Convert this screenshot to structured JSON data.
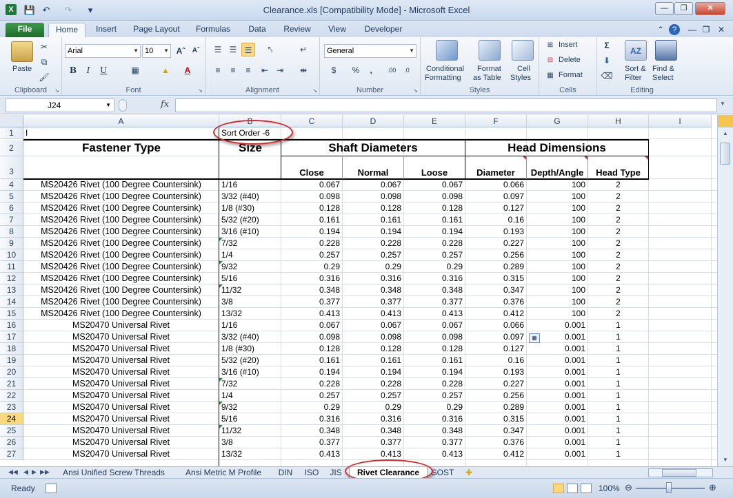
{
  "window": {
    "title": "Clearance.xls  [Compatibility Mode]  -  Microsoft Excel"
  },
  "ribbon_tabs": [
    "File",
    "Home",
    "Insert",
    "Page Layout",
    "Formulas",
    "Data",
    "Review",
    "View",
    "Developer"
  ],
  "ribbon": {
    "clipboard": {
      "label": "Clipboard",
      "paste": "Paste"
    },
    "font": {
      "label": "Font",
      "family": "Arial",
      "size": "10"
    },
    "alignment": {
      "label": "Alignment"
    },
    "number": {
      "label": "Number",
      "format": "General",
      "currency": "$",
      "percent": "%",
      "comma": ","
    },
    "styles": {
      "label": "Styles",
      "cond_fmt_1": "Conditional",
      "cond_fmt_2": "Formatting",
      "fmt_table_1": "Format",
      "fmt_table_2": "as Table",
      "cell_styles_1": "Cell",
      "cell_styles_2": "Styles"
    },
    "cells": {
      "label": "Cells",
      "insert": "Insert",
      "delete": "Delete",
      "format": "Format"
    },
    "editing": {
      "label": "Editing",
      "sort_1": "Sort &",
      "sort_2": "Filter",
      "find_1": "Find &",
      "find_2": "Select"
    }
  },
  "formula_bar": {
    "name_box": "J24",
    "fx": "fx",
    "formula": ""
  },
  "columns": [
    "A",
    "B",
    "C",
    "D",
    "E",
    "F",
    "G",
    "H",
    "I"
  ],
  "header_cells": {
    "a1": "I",
    "b1": "Sort Order -6",
    "fastener_type": "Fastener Type",
    "size": "Size",
    "shaft_diameters": "Shaft Diameters",
    "head_dimensions": "Head Dimensions",
    "close": "Close",
    "normal": "Normal",
    "loose": "Loose",
    "diameter": "Diameter",
    "depth_angle": "Depth/Angle",
    "head_type": "Head Type"
  },
  "rows": [
    {
      "n": "4",
      "a": "MS20426 Rivet (100 Degree Countersink)",
      "b": "1/16",
      "c": "0.067",
      "d": "0.067",
      "e": "0.067",
      "f": "0.066",
      "g": "100",
      "h": "2"
    },
    {
      "n": "5",
      "a": "MS20426 Rivet (100 Degree Countersink)",
      "b": "3/32 (#40)",
      "c": "0.098",
      "d": "0.098",
      "e": "0.098",
      "f": "0.097",
      "g": "100",
      "h": "2"
    },
    {
      "n": "6",
      "a": "MS20426 Rivet (100 Degree Countersink)",
      "b": "1/8 (#30)",
      "c": "0.128",
      "d": "0.128",
      "e": "0.128",
      "f": "0.127",
      "g": "100",
      "h": "2"
    },
    {
      "n": "7",
      "a": "MS20426 Rivet (100 Degree Countersink)",
      "b": "5/32 (#20)",
      "c": "0.161",
      "d": "0.161",
      "e": "0.161",
      "f": "0.16",
      "g": "100",
      "h": "2"
    },
    {
      "n": "8",
      "a": "MS20426 Rivet (100 Degree Countersink)",
      "b": "3/16 (#10)",
      "c": "0.194",
      "d": "0.194",
      "e": "0.194",
      "f": "0.193",
      "g": "100",
      "h": "2"
    },
    {
      "n": "9",
      "a": "MS20426 Rivet (100 Degree Countersink)",
      "b": "7/32",
      "c": "0.228",
      "d": "0.228",
      "e": "0.228",
      "f": "0.227",
      "g": "100",
      "h": "2"
    },
    {
      "n": "10",
      "a": "MS20426 Rivet (100 Degree Countersink)",
      "b": "1/4",
      "c": "0.257",
      "d": "0.257",
      "e": "0.257",
      "f": "0.256",
      "g": "100",
      "h": "2"
    },
    {
      "n": "11",
      "a": "MS20426 Rivet (100 Degree Countersink)",
      "b": "9/32",
      "c": "0.29",
      "d": "0.29",
      "e": "0.29",
      "f": "0.289",
      "g": "100",
      "h": "2"
    },
    {
      "n": "12",
      "a": "MS20426 Rivet (100 Degree Countersink)",
      "b": "5/16",
      "c": "0.316",
      "d": "0.316",
      "e": "0.316",
      "f": "0.315",
      "g": "100",
      "h": "2"
    },
    {
      "n": "13",
      "a": "MS20426 Rivet (100 Degree Countersink)",
      "b": "11/32",
      "c": "0.348",
      "d": "0.348",
      "e": "0.348",
      "f": "0.347",
      "g": "100",
      "h": "2"
    },
    {
      "n": "14",
      "a": "MS20426 Rivet (100 Degree Countersink)",
      "b": "3/8",
      "c": "0.377",
      "d": "0.377",
      "e": "0.377",
      "f": "0.376",
      "g": "100",
      "h": "2"
    },
    {
      "n": "15",
      "a": "MS20426 Rivet (100 Degree Countersink)",
      "b": "13/32",
      "c": "0.413",
      "d": "0.413",
      "e": "0.413",
      "f": "0.412",
      "g": "100",
      "h": "2"
    },
    {
      "n": "16",
      "a": "MS20470 Universal Rivet",
      "b": "1/16",
      "c": "0.067",
      "d": "0.067",
      "e": "0.067",
      "f": "0.066",
      "g": "0.001",
      "h": "1"
    },
    {
      "n": "17",
      "a": "MS20470 Universal Rivet",
      "b": "3/32 (#40)",
      "c": "0.098",
      "d": "0.098",
      "e": "0.098",
      "f": "0.097",
      "g": "0.001",
      "h": "1"
    },
    {
      "n": "18",
      "a": "MS20470 Universal Rivet",
      "b": "1/8 (#30)",
      "c": "0.128",
      "d": "0.128",
      "e": "0.128",
      "f": "0.127",
      "g": "0.001",
      "h": "1"
    },
    {
      "n": "19",
      "a": "MS20470 Universal Rivet",
      "b": "5/32 (#20)",
      "c": "0.161",
      "d": "0.161",
      "e": "0.161",
      "f": "0.16",
      "g": "0.001",
      "h": "1"
    },
    {
      "n": "20",
      "a": "MS20470 Universal Rivet",
      "b": "3/16 (#10)",
      "c": "0.194",
      "d": "0.194",
      "e": "0.194",
      "f": "0.193",
      "g": "0.001",
      "h": "1"
    },
    {
      "n": "21",
      "a": "MS20470 Universal Rivet",
      "b": "7/32",
      "c": "0.228",
      "d": "0.228",
      "e": "0.228",
      "f": "0.227",
      "g": "0.001",
      "h": "1"
    },
    {
      "n": "22",
      "a": "MS20470 Universal Rivet",
      "b": "1/4",
      "c": "0.257",
      "d": "0.257",
      "e": "0.257",
      "f": "0.256",
      "g": "0.001",
      "h": "1"
    },
    {
      "n": "23",
      "a": "MS20470 Universal Rivet",
      "b": "9/32",
      "c": "0.29",
      "d": "0.29",
      "e": "0.29",
      "f": "0.289",
      "g": "0.001",
      "h": "1"
    },
    {
      "n": "24",
      "a": "MS20470 Universal Rivet",
      "b": "5/16",
      "c": "0.316",
      "d": "0.316",
      "e": "0.316",
      "f": "0.315",
      "g": "0.001",
      "h": "1"
    },
    {
      "n": "25",
      "a": "MS20470 Universal Rivet",
      "b": "11/32",
      "c": "0.348",
      "d": "0.348",
      "e": "0.348",
      "f": "0.347",
      "g": "0.001",
      "h": "1"
    },
    {
      "n": "26",
      "a": "MS20470 Universal Rivet",
      "b": "3/8",
      "c": "0.377",
      "d": "0.377",
      "e": "0.377",
      "f": "0.376",
      "g": "0.001",
      "h": "1"
    },
    {
      "n": "27",
      "a": "MS20470 Universal Rivet",
      "b": "13/32",
      "c": "0.413",
      "d": "0.413",
      "e": "0.413",
      "f": "0.412",
      "g": "0.001",
      "h": "1"
    }
  ],
  "selected_row": "24",
  "sheet_tabs": [
    "Ansi Unified Screw Threads",
    "Ansi Metric M Profile",
    "DIN",
    "ISO",
    "JIS",
    "Rivet Clearance",
    "SOST"
  ],
  "active_sheet": "Rivet Clearance",
  "status": {
    "ready": "Ready",
    "zoom": "100%"
  },
  "colors": {
    "accent_green": "#1f7a3a",
    "annotation_red": "#d52a2a",
    "selected_row": "#f9d87f"
  }
}
